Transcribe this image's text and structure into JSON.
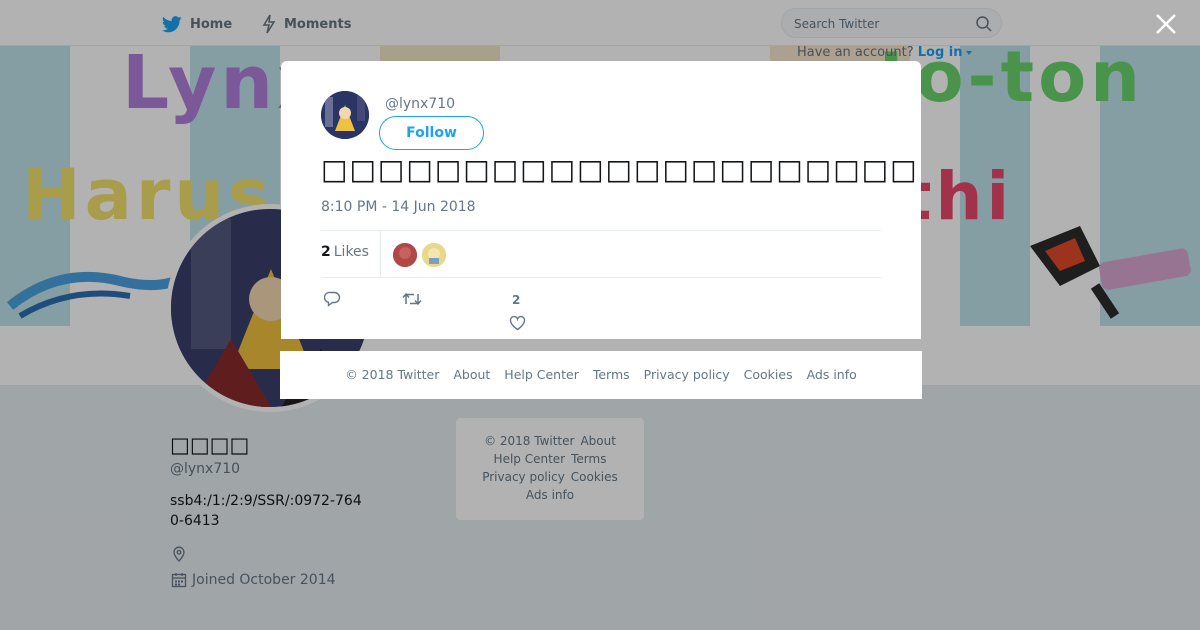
{
  "nav": {
    "home_label": "Home",
    "moments_label": "Moments",
    "search_placeholder": "Search Twitter",
    "have_account": "Have an account?",
    "login_label": "Log in"
  },
  "banner": {
    "words": [
      "Lynx",
      "Harus",
      "to-ton",
      "thi"
    ]
  },
  "profile": {
    "name": "□□□□",
    "handle": "@lynx710",
    "bio": "ssb4:/1:/2:9/SSR/:0972-7640-6413",
    "joined": "Joined October 2014"
  },
  "side_footer": {
    "copyright": "© 2018 Twitter",
    "about": "About",
    "help": "Help Center",
    "terms": "Terms",
    "privacy": "Privacy policy",
    "cookies": "Cookies",
    "ads": "Ads info"
  },
  "tweet": {
    "handle": "@lynx710",
    "follow_label": "Follow",
    "text": "□□□□□□□□□□□□□□□□□□□□□□□□□",
    "timestamp": "8:10 PM - 14 Jun 2018",
    "likes_count": "2",
    "likes_label": "Likes",
    "like_action_count": "2"
  },
  "modal_footer": {
    "copyright": "© 2018 Twitter",
    "about": "About",
    "help": "Help Center",
    "terms": "Terms",
    "privacy": "Privacy policy",
    "cookies": "Cookies",
    "ads": "Ads info"
  },
  "colors": {
    "accent": "#1da1f2",
    "muted": "#657786",
    "background": "#e6ecf0"
  },
  "icons": [
    "twitter-bird-icon",
    "lightning-icon",
    "search-icon",
    "close-icon",
    "location-icon",
    "calendar-icon",
    "reply-icon",
    "retweet-icon",
    "heart-icon"
  ]
}
